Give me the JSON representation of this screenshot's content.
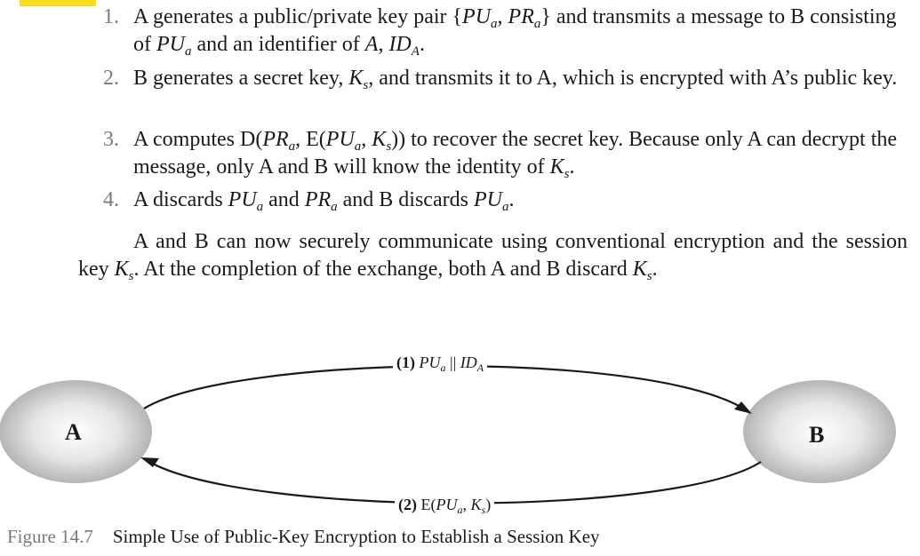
{
  "highlight_color": "#f7dd1e",
  "steps": [
    {
      "number": "1.",
      "text": "A generates a public/private key pair {PUa, PRa} and transmits a message to B consisting of PUa and an identifier of A, IDA."
    },
    {
      "number": "2.",
      "text": "B generates a secret key, Ks, and transmits it to A, which is encrypted with A’s public key."
    },
    {
      "number": "3.",
      "text": "A computes D(PRa, E(PUa, Ks)) to recover the secret key. Because only A can decrypt the message, only A and B will know the identity of Ks."
    },
    {
      "number": "4.",
      "text": "A discards PUa and PRa and B discards PUa."
    }
  ],
  "paragraph": "A and B can now securely communicate using conventional encryption and the session key Ks. At the completion of the exchange, both A and B discard Ks.",
  "diagram": {
    "node_a": "A",
    "node_b": "B",
    "arrow_1_label": "(1) PUa || IDA",
    "arrow_2_label": "(2) E(PUa, Ks)"
  },
  "caption": {
    "figure": "Figure 14.7",
    "title": "Simple Use of Public-Key Encryption to Establish a Session Key"
  }
}
